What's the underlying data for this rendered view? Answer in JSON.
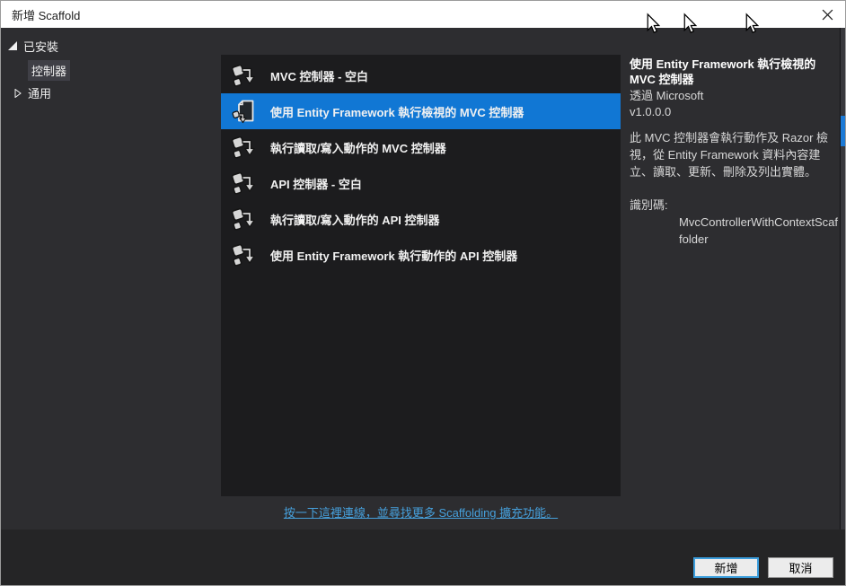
{
  "window": {
    "title": "新增 Scaffold"
  },
  "sidebar": {
    "root_label": "已安裝",
    "items": [
      {
        "label": "控制器",
        "selected": true
      },
      {
        "label": "通用",
        "collapsed": true
      }
    ]
  },
  "list": {
    "items": [
      {
        "label": "MVC 控制器 - 空白",
        "icon": "controller-scaffold-icon",
        "selected": false
      },
      {
        "label": "使用 Entity Framework 執行檢視的 MVC 控制器",
        "icon": "ef-view-controller-icon",
        "selected": true
      },
      {
        "label": "執行讀取/寫入動作的 MVC 控制器",
        "icon": "controller-scaffold-icon",
        "selected": false
      },
      {
        "label": "API 控制器 - 空白",
        "icon": "controller-scaffold-icon",
        "selected": false
      },
      {
        "label": "執行讀取/寫入動作的 API 控制器",
        "icon": "controller-scaffold-icon",
        "selected": false
      },
      {
        "label": "使用 Entity Framework 執行動作的 API 控制器",
        "icon": "controller-scaffold-icon",
        "selected": false
      }
    ],
    "link_text": "按一下這裡連線，並尋找更多 Scaffolding 擴充功能。"
  },
  "details": {
    "title": "使用 Entity Framework 執行檢視的 MVC 控制器",
    "publisher": "透過 Microsoft",
    "version": "v1.0.0.0",
    "description": "此 MVC 控制器會執行動作及 Razor 檢視，從 Entity Framework 資料內容建立、讀取、更新、刪除及列出實體。",
    "identifier": "識別碼: MvcControllerWithContextScaffolder"
  },
  "footer": {
    "add_label": "新增",
    "cancel_label": "取消"
  },
  "colors": {
    "accent_blue": "#1177d4",
    "link_blue": "#46a0dc",
    "body_bg": "#2d2d30",
    "list_bg": "#1c1c1e",
    "footer_bg": "#252526",
    "titlebar_bg": "#ffffff"
  },
  "icons": [
    "close-icon",
    "triangle-expanded-icon",
    "triangle-collapsed-icon",
    "controller-scaffold-icon",
    "ef-view-controller-icon",
    "mouse-cursor-icon"
  ]
}
